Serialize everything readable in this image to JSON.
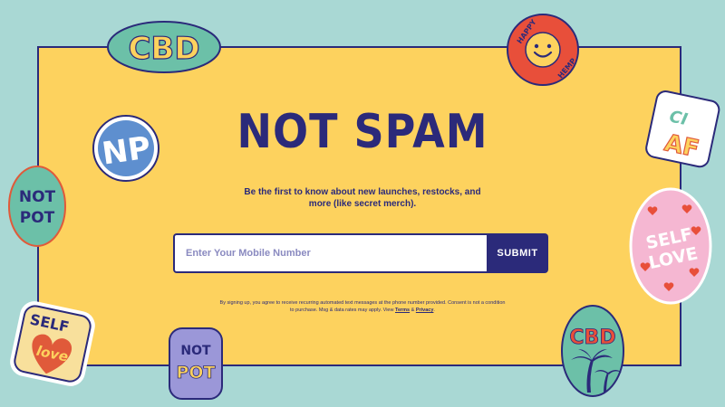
{
  "headline": "NOT SPAM",
  "subtitle": "Be the first to know about new launches, restocks, and more (like secret merch).",
  "form": {
    "placeholder": "Enter Your Mobile Number",
    "submit_label": "SUBMIT"
  },
  "legal": {
    "text_before": "By signing up, you agree to receive recurring automated text messages at the phone number provided. Consent is not a condition to purchase. Msg & data rates may apply. View ",
    "terms_label": "Terms",
    "joiner": " & ",
    "privacy_label": "Privacy",
    "text_after": "."
  },
  "stickers": {
    "cbd_top": "CBD",
    "np": "NP",
    "not_pot_left": [
      "NOT",
      "POT"
    ],
    "self_love_left": [
      "SELF",
      "love"
    ],
    "not_pot_bottom": [
      "NOT",
      "POT"
    ],
    "happy_hemp": [
      "HAPPY",
      "HEMP"
    ],
    "ai_top": "CI",
    "ai_bottom": "AF",
    "self_love_right": [
      "SELF",
      "LOVE"
    ],
    "cbd_bottom": "CBD"
  },
  "colors": {
    "background": "#a9d8d4",
    "panel": "#fdd25e",
    "navy": "#2b2a7a"
  }
}
